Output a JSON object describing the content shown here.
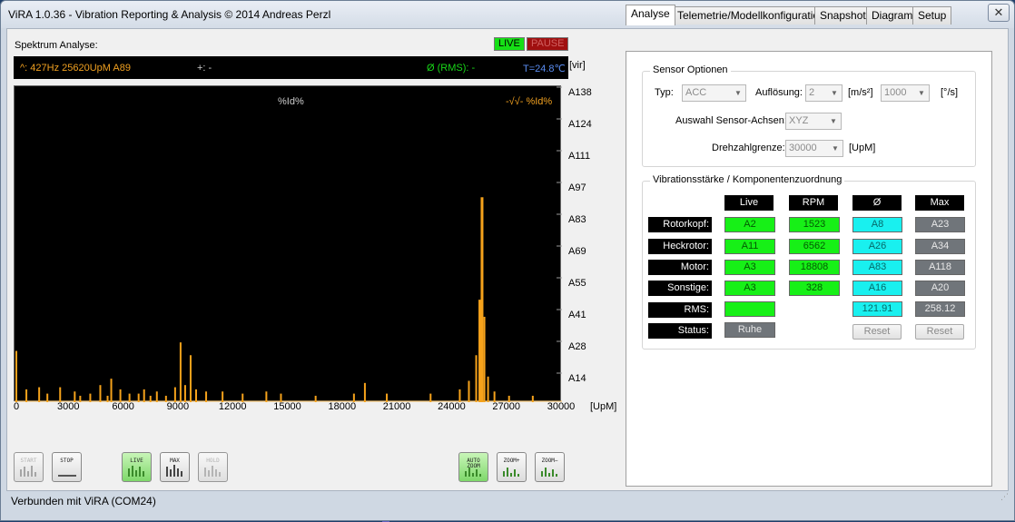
{
  "window": {
    "title": "ViRA 1.0.36  -  Vibration Reporting & Analysis © 2014 Andreas Perzl",
    "close": "✕"
  },
  "spectrum": {
    "label": "Spektrum Analyse:",
    "badge_live": "LIVE",
    "badge_pause": "PAUSE",
    "status_freq": "^: 427Hz  25620UpM  A89",
    "status_plus": "+: -",
    "status_rms": "Ø (RMS): -",
    "status_temp": "T=24.8℃",
    "unit_label": "[vir]",
    "plot_header_center": "%Id%",
    "plot_header_right": "-√√-  %Id%",
    "y_ticks": [
      "A138",
      "A124",
      "A111",
      "A97",
      "A83",
      "A69",
      "A55",
      "A41",
      "A28",
      "A14"
    ],
    "x_ticks": [
      "0",
      "3000",
      "6000",
      "9000",
      "12000",
      "15000",
      "18000",
      "21000",
      "24000",
      "27000",
      "30000"
    ],
    "x_unit": "[UpM]"
  },
  "chart_data": {
    "type": "bar",
    "x_unit": "UpM",
    "xlim": [
      0,
      30000
    ],
    "ylim": [
      0,
      148
    ],
    "color": "#f5a21b",
    "background": "#000000",
    "peaks": [
      {
        "x": 100,
        "y": 24
      },
      {
        "x": 650,
        "y": 6
      },
      {
        "x": 1350,
        "y": 7
      },
      {
        "x": 1800,
        "y": 4
      },
      {
        "x": 2500,
        "y": 7
      },
      {
        "x": 3300,
        "y": 5
      },
      {
        "x": 3600,
        "y": 3
      },
      {
        "x": 4150,
        "y": 4
      },
      {
        "x": 4700,
        "y": 8
      },
      {
        "x": 5100,
        "y": 3
      },
      {
        "x": 5300,
        "y": 11
      },
      {
        "x": 5800,
        "y": 6
      },
      {
        "x": 6300,
        "y": 4
      },
      {
        "x": 6800,
        "y": 4
      },
      {
        "x": 7100,
        "y": 6
      },
      {
        "x": 7450,
        "y": 3
      },
      {
        "x": 7800,
        "y": 5
      },
      {
        "x": 8300,
        "y": 3
      },
      {
        "x": 8800,
        "y": 7
      },
      {
        "x": 9100,
        "y": 28
      },
      {
        "x": 9350,
        "y": 8
      },
      {
        "x": 9650,
        "y": 22
      },
      {
        "x": 9950,
        "y": 6
      },
      {
        "x": 10500,
        "y": 5
      },
      {
        "x": 11400,
        "y": 5
      },
      {
        "x": 12500,
        "y": 4
      },
      {
        "x": 13800,
        "y": 5
      },
      {
        "x": 14600,
        "y": 4
      },
      {
        "x": 16500,
        "y": 3
      },
      {
        "x": 18600,
        "y": 4
      },
      {
        "x": 19200,
        "y": 9
      },
      {
        "x": 20400,
        "y": 4
      },
      {
        "x": 22800,
        "y": 4
      },
      {
        "x": 24400,
        "y": 6
      },
      {
        "x": 24900,
        "y": 10
      },
      {
        "x": 25300,
        "y": 22
      },
      {
        "x": 25500,
        "y": 48
      },
      {
        "x": 25620,
        "y": 96
      },
      {
        "x": 25750,
        "y": 40
      },
      {
        "x": 25950,
        "y": 12
      },
      {
        "x": 26300,
        "y": 5
      },
      {
        "x": 27100,
        "y": 3
      },
      {
        "x": 28400,
        "y": 3
      }
    ],
    "title": "%Id%",
    "xlabel": "[UpM]",
    "ylabel": "[vir]",
    "grid": false
  },
  "buttons": {
    "start": "START",
    "stop": "STOP",
    "live": "LIVE",
    "max": "MAX",
    "hold": "HOLD",
    "autozoom": "AUTO ZOOM",
    "zoomin": "ZOOM+",
    "zoomout": "ZOOM−"
  },
  "tabs": [
    "Analyse",
    "Telemetrie/Modellkonfiguration",
    "Snapshot",
    "Diagram",
    "Setup"
  ],
  "sensor": {
    "group_title": "Sensor Optionen",
    "typ_label": "Typ:",
    "typ_value": "ACC",
    "aufl_label": "Auflösung:",
    "aufl_value": "2",
    "aufl_unit": "[m/s²]",
    "rate_value": "1000",
    "rate_unit": "[°/s]",
    "axes_label": "Auswahl Sensor-Achsen:",
    "axes_value": "XYZ",
    "rpm_label": "Drehzahlgrenze:",
    "rpm_value": "30000",
    "rpm_unit": "[UpM]"
  },
  "vib": {
    "group_title": "Vibrationsstärke / Komponentenzuordnung",
    "headers": [
      "Live",
      "RPM",
      "Ø",
      "Max"
    ],
    "rows": [
      {
        "label": "Rotorkopf:",
        "live": "A2",
        "rpm": "1523",
        "avg": "A8",
        "max": "A23"
      },
      {
        "label": "Heckrotor:",
        "live": "A11",
        "rpm": "6562",
        "avg": "A26",
        "max": "A34"
      },
      {
        "label": "Motor:",
        "live": "A3",
        "rpm": "18808",
        "avg": "A83",
        "max": "A118"
      },
      {
        "label": "Sonstige:",
        "live": "A3",
        "rpm": "328",
        "avg": "A16",
        "max": "A20"
      }
    ],
    "rms_label": "RMS:",
    "rms_live": "",
    "rms_avg": "121.91",
    "rms_max": "258.12",
    "status_label": "Status:",
    "status_value": "Ruhe",
    "reset": "Reset"
  },
  "footer": {
    "status": "Verbunden mit ViRA (COM24)"
  },
  "colors": {
    "accent_green": "#17f017",
    "accent_cyan": "#19f0ef",
    "spectrum_orange": "#f5a21b",
    "status_blue": "#5a8cf0"
  }
}
